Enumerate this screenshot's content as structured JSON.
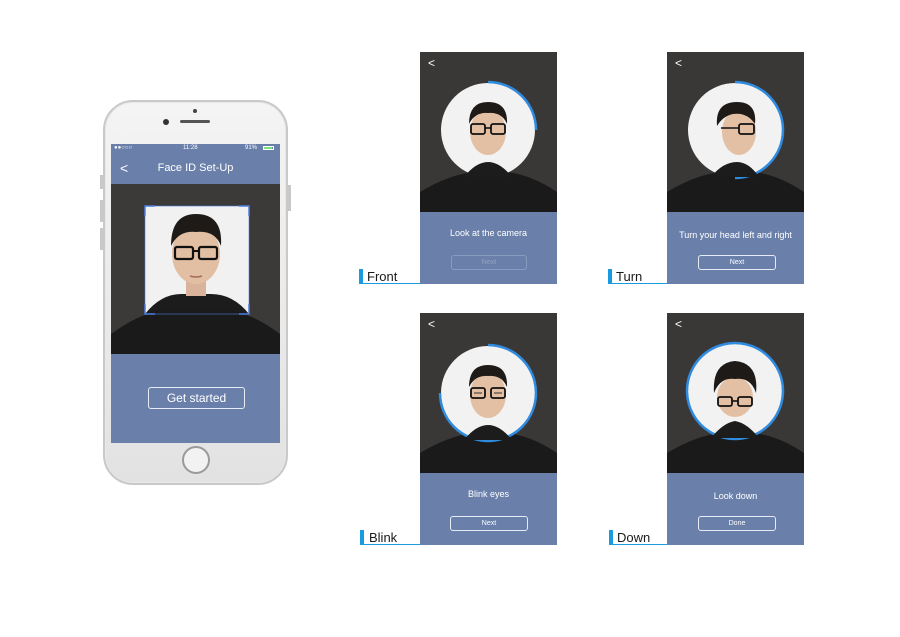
{
  "phone": {
    "status": {
      "carrier": "●●○○○",
      "time": "11:28",
      "battery": "91%"
    },
    "title": "Face ID Set-Up",
    "back": "<",
    "button": "Get started"
  },
  "panels": [
    {
      "label": "Front",
      "back": "<",
      "instruction": "Look at the camera",
      "button": "Next",
      "progress": 0.25
    },
    {
      "label": "Turn",
      "back": "<",
      "instruction": "Turn your head left and right",
      "button": "Next",
      "progress": 0.5
    },
    {
      "label": "Blink",
      "back": "<",
      "instruction": "Blink eyes",
      "button": "Next",
      "progress": 0.75
    },
    {
      "label": "Down",
      "back": "<",
      "instruction": "Look down",
      "button": "Done",
      "progress": 1.0
    }
  ],
  "colors": {
    "screen_blue": "#6a80ab",
    "accent": "#1a9be0",
    "ring": "#2f8be0"
  }
}
